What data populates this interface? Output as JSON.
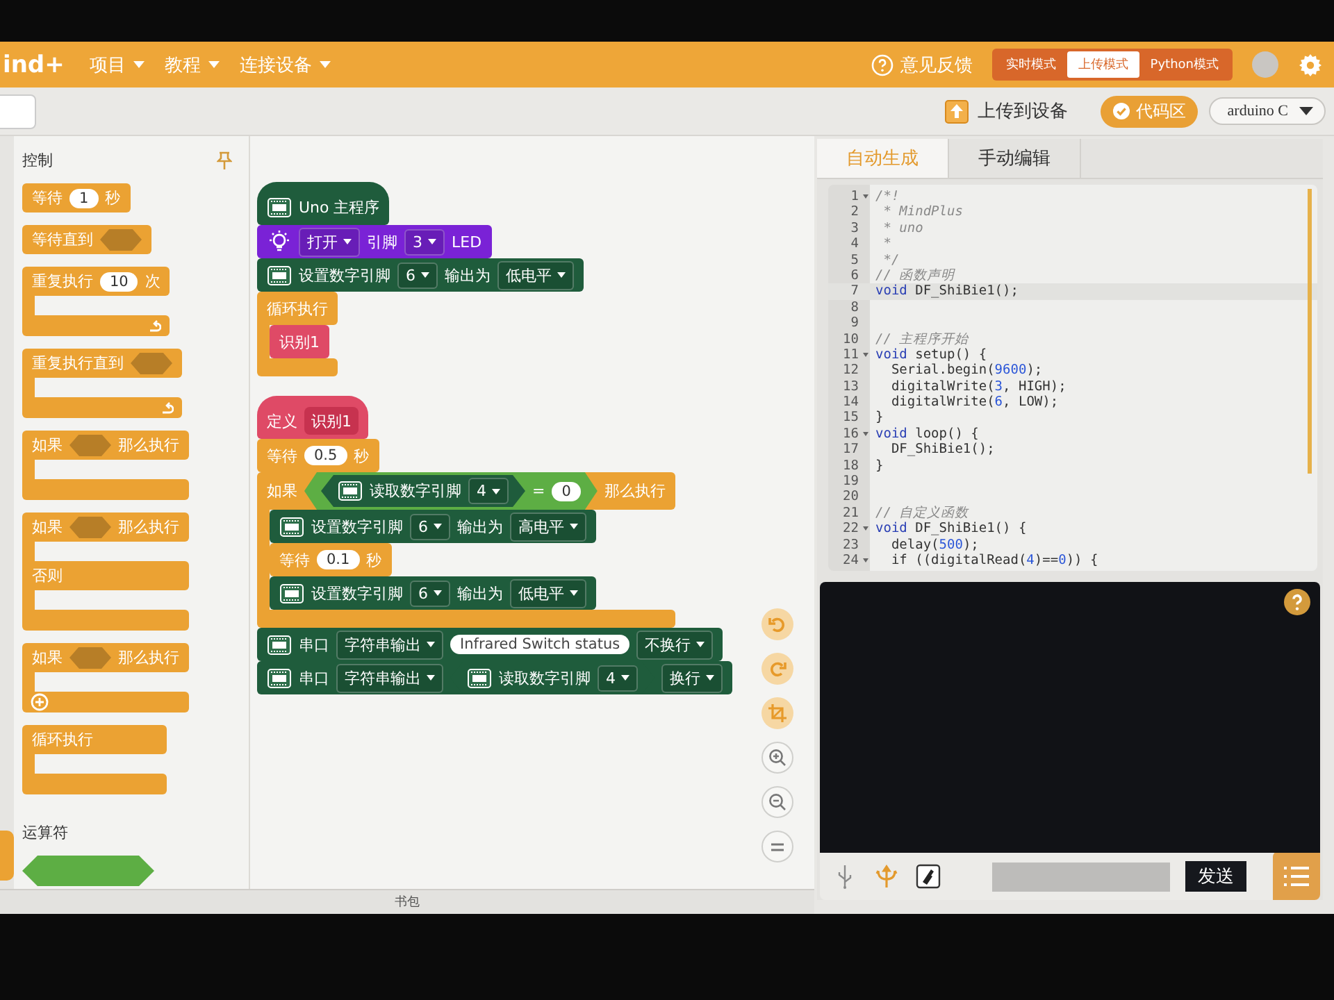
{
  "menu_bar": {
    "logo": "ind+",
    "menus": [
      "项目",
      "教程",
      "连接设备"
    ],
    "feedback": "意见反馈",
    "modes": [
      {
        "label": "实时模式",
        "selected": false
      },
      {
        "label": "上传模式",
        "selected": true
      },
      {
        "label": "Python模式",
        "selected": false
      }
    ]
  },
  "toolbar": {
    "upload_button": "上传到设备",
    "code_toggle": {
      "label": "代码区",
      "on": true
    },
    "board_select": "arduino C"
  },
  "palette": {
    "sections": [
      {
        "title": "控制",
        "blocks": [
          {
            "kind": "stack",
            "color": "#eba233",
            "parts": [
              {
                "kind": "text",
                "text": "等待"
              },
              {
                "kind": "number",
                "text": "1"
              },
              {
                "kind": "text",
                "text": "秒"
              }
            ]
          },
          {
            "kind": "stack",
            "color": "#eba233",
            "parts": [
              {
                "kind": "text",
                "text": "等待直到"
              },
              {
                "kind": "slot"
              }
            ]
          },
          {
            "kind": "c",
            "color": "#eba233",
            "footer": {
              "kind": "loop"
            },
            "parts": [
              {
                "kind": "text",
                "text": "重复执行"
              },
              {
                "kind": "number",
                "text": "10"
              },
              {
                "kind": "text",
                "text": "次"
              }
            ]
          },
          {
            "kind": "c",
            "color": "#eba233",
            "footer": {
              "kind": "loop"
            },
            "parts": [
              {
                "kind": "text",
                "text": "重复执行直到"
              },
              {
                "kind": "slot"
              }
            ]
          },
          {
            "kind": "c",
            "color": "#eba233",
            "parts": [
              {
                "kind": "text",
                "text": "如果"
              },
              {
                "kind": "slot"
              },
              {
                "kind": "text",
                "text": "那么执行"
              }
            ]
          },
          {
            "kind": "c",
            "color": "#eba233",
            "parts": [
              {
                "kind": "text",
                "text": "如果"
              },
              {
                "kind": "slot"
              },
              {
                "kind": "text",
                "text": "那么执行"
              }
            ],
            "branches": [
              {
                "parts": [
                  {
                    "kind": "text",
                    "text": "否则"
                  }
                ]
              }
            ]
          },
          {
            "kind": "c",
            "color": "#eba233",
            "footer": {
              "kind": "plus"
            },
            "parts": [
              {
                "kind": "text",
                "text": "如果"
              },
              {
                "kind": "slot"
              },
              {
                "kind": "text",
                "text": "那么执行"
              }
            ]
          },
          {
            "kind": "c",
            "color": "#eba233",
            "parts": [
              {
                "kind": "text",
                "text": "循环执行"
              }
            ]
          }
        ]
      },
      {
        "title": "运算符",
        "blocks": [
          {
            "kind": "boolean",
            "color": "#5dae44"
          }
        ]
      }
    ]
  },
  "workspace": {
    "scripts": [
      {
        "blocks": [
          {
            "kind": "hat",
            "color": "#1f5c3c",
            "parts": [
              {
                "kind": "board"
              },
              {
                "kind": "text",
                "text": "Uno 主程序"
              }
            ]
          },
          {
            "kind": "stack",
            "color": "#7a22d6",
            "parts": [
              {
                "kind": "bulb"
              },
              {
                "kind": "dropdown",
                "text": "打开"
              },
              {
                "kind": "text",
                "text": "引脚"
              },
              {
                "kind": "dropdown",
                "text": "3"
              },
              {
                "kind": "text",
                "text": "LED"
              }
            ]
          },
          {
            "kind": "stack",
            "color": "#1f5c3c",
            "parts": [
              {
                "kind": "board"
              },
              {
                "kind": "text",
                "text": "设置数字引脚"
              },
              {
                "kind": "dropdown",
                "text": "6"
              },
              {
                "kind": "text",
                "text": "输出为"
              },
              {
                "kind": "dropdown",
                "text": "低电平"
              }
            ]
          },
          {
            "kind": "c",
            "color": "#eba233",
            "parts": [
              {
                "kind": "text",
                "text": "循环执行"
              }
            ],
            "children": [
              {
                "kind": "stack",
                "color": "#df4a66",
                "parts": [
                  {
                    "kind": "text",
                    "text": "识别1"
                  }
                ]
              }
            ]
          }
        ]
      },
      {
        "blocks": [
          {
            "kind": "hat",
            "color": "#df4a66",
            "parts": [
              {
                "kind": "text",
                "text": "定义"
              },
              {
                "kind": "rect_reporter",
                "color": "#c7324f",
                "parts": [
                  {
                    "kind": "text",
                    "text": "识别1"
                  }
                ]
              }
            ]
          },
          {
            "kind": "stack",
            "color": "#eba233",
            "parts": [
              {
                "kind": "text",
                "text": "等待"
              },
              {
                "kind": "number",
                "text": "0.5"
              },
              {
                "kind": "text",
                "text": "秒"
              }
            ]
          },
          {
            "kind": "c",
            "color": "#eba233",
            "parts": [
              {
                "kind": "text",
                "text": "如果"
              },
              {
                "kind": "hex_reporter",
                "color": "#5dae44",
                "parts": [
                  {
                    "kind": "hex_reporter",
                    "color": "#1f5c3c",
                    "parts": [
                      {
                        "kind": "board"
                      },
                      {
                        "kind": "text",
                        "text": "读取数字引脚"
                      },
                      {
                        "kind": "dropdown",
                        "text": "4"
                      }
                    ]
                  },
                  {
                    "kind": "text",
                    "text": "="
                  },
                  {
                    "kind": "number",
                    "text": "0"
                  }
                ]
              },
              {
                "kind": "text",
                "text": "那么执行"
              }
            ],
            "children": [
              {
                "kind": "stack",
                "color": "#1f5c3c",
                "parts": [
                  {
                    "kind": "board"
                  },
                  {
                    "kind": "text",
                    "text": "设置数字引脚"
                  },
                  {
                    "kind": "dropdown",
                    "text": "6"
                  },
                  {
                    "kind": "text",
                    "text": "输出为"
                  },
                  {
                    "kind": "dropdown",
                    "text": "高电平"
                  }
                ]
              },
              {
                "kind": "stack",
                "color": "#eba233",
                "parts": [
                  {
                    "kind": "text",
                    "text": "等待"
                  },
                  {
                    "kind": "number",
                    "text": "0.1"
                  },
                  {
                    "kind": "text",
                    "text": "秒"
                  }
                ]
              },
              {
                "kind": "stack",
                "color": "#1f5c3c",
                "parts": [
                  {
                    "kind": "board"
                  },
                  {
                    "kind": "text",
                    "text": "设置数字引脚"
                  },
                  {
                    "kind": "dropdown",
                    "text": "6"
                  },
                  {
                    "kind": "text",
                    "text": "输出为"
                  },
                  {
                    "kind": "dropdown",
                    "text": "低电平"
                  }
                ]
              }
            ]
          },
          {
            "kind": "stack",
            "color": "#1f5c3c",
            "parts": [
              {
                "kind": "board"
              },
              {
                "kind": "text",
                "text": "串口"
              },
              {
                "kind": "dropdown",
                "text": "字符串输出"
              },
              {
                "kind": "string",
                "text": "Infrared Switch status"
              },
              {
                "kind": "dropdown",
                "text": "不换行"
              }
            ]
          },
          {
            "kind": "stack",
            "color": "#1f5c3c",
            "parts": [
              {
                "kind": "board"
              },
              {
                "kind": "text",
                "text": "串口"
              },
              {
                "kind": "dropdown",
                "text": "字符串输出"
              },
              {
                "kind": "hex_reporter",
                "color": "#1f5c3c",
                "parts": [
                  {
                    "kind": "board"
                  },
                  {
                    "kind": "text",
                    "text": "读取数字引脚"
                  },
                  {
                    "kind": "dropdown",
                    "text": "4"
                  }
                ]
              },
              {
                "kind": "dropdown",
                "text": "换行"
              }
            ]
          }
        ]
      }
    ]
  },
  "code_panel": {
    "tabs": [
      {
        "label": "自动生成",
        "selected": true
      },
      {
        "label": "手动编辑",
        "selected": false
      }
    ],
    "lines": [
      {
        "number": "1",
        "foldable": true,
        "highlighted": false,
        "tokens": [
          {
            "kind": "comment",
            "text": "/*!"
          }
        ]
      },
      {
        "number": "2",
        "foldable": false,
        "highlighted": false,
        "tokens": [
          {
            "kind": "comment",
            "text": " * MindPlus"
          }
        ]
      },
      {
        "number": "3",
        "foldable": false,
        "highlighted": false,
        "tokens": [
          {
            "kind": "comment",
            "text": " * uno"
          }
        ]
      },
      {
        "number": "4",
        "foldable": false,
        "highlighted": false,
        "tokens": [
          {
            "kind": "comment",
            "text": " *"
          }
        ]
      },
      {
        "number": "5",
        "foldable": false,
        "highlighted": false,
        "tokens": [
          {
            "kind": "comment",
            "text": " */"
          }
        ]
      },
      {
        "number": "6",
        "foldable": false,
        "highlighted": false,
        "tokens": [
          {
            "kind": "comment",
            "text": "// 函数声明"
          }
        ]
      },
      {
        "number": "7",
        "foldable": false,
        "highlighted": true,
        "tokens": [
          {
            "kind": "keyword",
            "text": "void"
          },
          {
            "kind": "plain",
            "text": " DF_ShiBie1();"
          }
        ]
      },
      {
        "number": "8",
        "foldable": false,
        "highlighted": false
      },
      {
        "number": "9",
        "foldable": false,
        "highlighted": false
      },
      {
        "number": "10",
        "foldable": false,
        "highlighted": false,
        "tokens": [
          {
            "kind": "comment",
            "text": "// 主程序开始"
          }
        ]
      },
      {
        "number": "11",
        "foldable": true,
        "highlighted": false,
        "tokens": [
          {
            "kind": "keyword",
            "text": "void"
          },
          {
            "kind": "plain",
            "text": " setup() {"
          }
        ]
      },
      {
        "number": "12",
        "foldable": false,
        "highlighted": false,
        "tokens": [
          {
            "kind": "plain",
            "text": "  Serial.begin("
          },
          {
            "kind": "number",
            "text": "9600"
          },
          {
            "kind": "plain",
            "text": ");"
          }
        ]
      },
      {
        "number": "13",
        "foldable": false,
        "highlighted": false,
        "tokens": [
          {
            "kind": "plain",
            "text": "  digitalWrite("
          },
          {
            "kind": "number",
            "text": "3"
          },
          {
            "kind": "plain",
            "text": ", HIGH);"
          }
        ]
      },
      {
        "number": "14",
        "foldable": false,
        "highlighted": false,
        "tokens": [
          {
            "kind": "plain",
            "text": "  digitalWrite("
          },
          {
            "kind": "number",
            "text": "6"
          },
          {
            "kind": "plain",
            "text": ", LOW);"
          }
        ]
      },
      {
        "number": "15",
        "foldable": false,
        "highlighted": false,
        "tokens": [
          {
            "kind": "plain",
            "text": "}"
          }
        ]
      },
      {
        "number": "16",
        "foldable": true,
        "highlighted": false,
        "tokens": [
          {
            "kind": "keyword",
            "text": "void"
          },
          {
            "kind": "plain",
            "text": " loop() {"
          }
        ]
      },
      {
        "number": "17",
        "foldable": false,
        "highlighted": false,
        "tokens": [
          {
            "kind": "plain",
            "text": "  DF_ShiBie1();"
          }
        ]
      },
      {
        "number": "18",
        "foldable": false,
        "highlighted": false,
        "tokens": [
          {
            "kind": "plain",
            "text": "}"
          }
        ]
      },
      {
        "number": "19",
        "foldable": false,
        "highlighted": false
      },
      {
        "number": "20",
        "foldable": false,
        "highlighted": false
      },
      {
        "number": "21",
        "foldable": false,
        "highlighted": false,
        "tokens": [
          {
            "kind": "comment",
            "text": "// 自定义函数"
          }
        ]
      },
      {
        "number": "22",
        "foldable": true,
        "highlighted": false,
        "tokens": [
          {
            "kind": "keyword",
            "text": "void"
          },
          {
            "kind": "plain",
            "text": " DF_ShiBie1() {"
          }
        ]
      },
      {
        "number": "23",
        "foldable": false,
        "highlighted": false,
        "tokens": [
          {
            "kind": "plain",
            "text": "  delay("
          },
          {
            "kind": "number",
            "text": "500"
          },
          {
            "kind": "plain",
            "text": ");"
          }
        ]
      },
      {
        "number": "24",
        "foldable": true,
        "highlighted": false,
        "tokens": [
          {
            "kind": "plain",
            "text": "  if ((digitalRead("
          },
          {
            "kind": "number",
            "text": "4"
          },
          {
            "kind": "plain",
            "text": ")=="
          },
          {
            "kind": "number",
            "text": "0"
          },
          {
            "kind": "plain",
            "text": ")) {"
          }
        ]
      }
    ]
  },
  "serial_panel": {
    "send_button": "发送"
  },
  "backpack": "书包"
}
